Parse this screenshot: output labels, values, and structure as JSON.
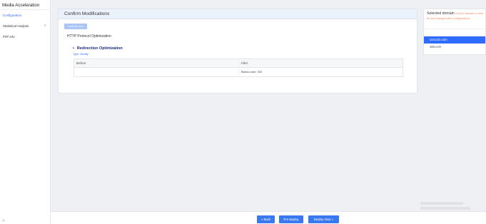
{
  "sidebar": {
    "title": "Media Acceleration",
    "items": [
      {
        "label": "Configuration",
        "active": true
      },
      {
        "label": "Statistical Analysis",
        "has_chevron": true
      },
      {
        "label": "P2P info"
      }
    ],
    "chevron_glyph": "∨",
    "collapse_glyph": "«"
  },
  "main": {
    "header": "Confirm Modifications",
    "domain_tag": "xxx1231.com",
    "section_title": "HTTP Protocol Optimization",
    "sub_title": "Redirection Optimization",
    "type_label": "Type: Modify",
    "table": {
      "headers": [
        "Before",
        "After"
      ],
      "rows": [
        [
          "",
          "Status code: 302"
        ]
      ]
    }
  },
  "right_panel": {
    "title": "Selected domain",
    "hint": "(Click a domain to view its new changes after configuration)",
    "domains": [
      {
        "label": "xxx1231.com",
        "active": true
      },
      {
        "label": "163.com",
        "active": false
      }
    ]
  },
  "footer": {
    "back": "« Back",
    "pre_deploy": "Pre-deploy",
    "deploy_now": "Deploy Now »"
  },
  "colors": {
    "accent": "#2f6bff",
    "button": "#3a78f2",
    "hint": "#f08a5d",
    "header_bg": "#eaf2fb"
  }
}
